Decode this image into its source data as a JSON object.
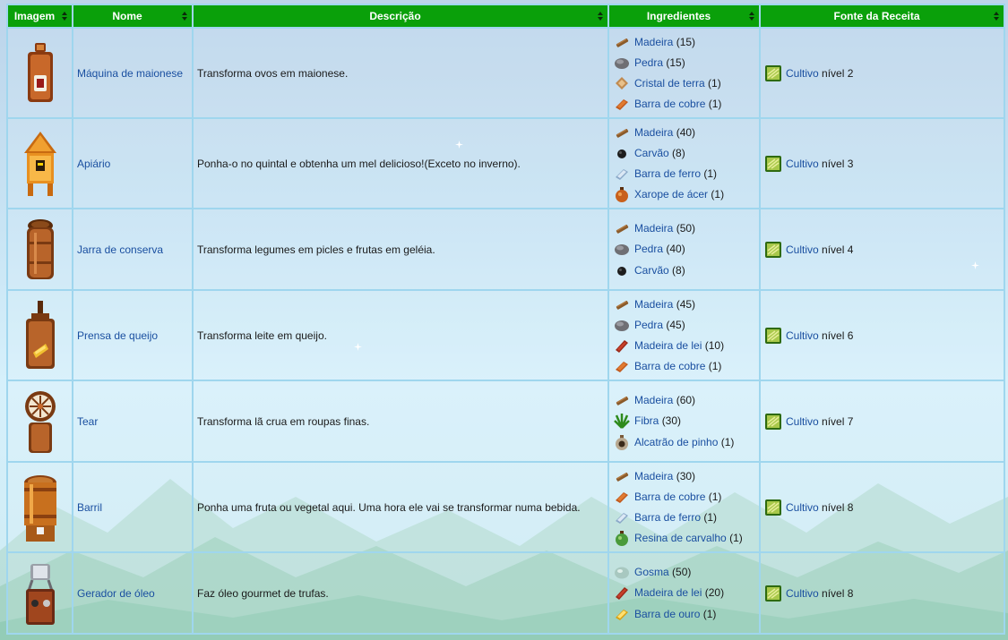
{
  "headers": {
    "image": "Imagem",
    "name": "Nome",
    "description": "Descrição",
    "ingredients": "Ingredientes",
    "source": "Fonte da Receita"
  },
  "rows": [
    {
      "icon": "mayonnaise-machine-icon",
      "name": "Máquina de maionese",
      "description": "Transforma ovos em maionese.",
      "ingredients": [
        {
          "icon": "wood-icon",
          "name": "Madeira",
          "qty": "(15)"
        },
        {
          "icon": "stone-icon",
          "name": "Pedra",
          "qty": "(15)"
        },
        {
          "icon": "earth-crystal-icon",
          "name": "Cristal de terra",
          "qty": "(1)"
        },
        {
          "icon": "copper-bar-icon",
          "name": "Barra de cobre",
          "qty": "(1)"
        }
      ],
      "source": {
        "link": "Cultivo",
        "level": "nível 2"
      }
    },
    {
      "icon": "bee-house-icon",
      "name": "Apiário",
      "description": "Ponha-o no quintal e obtenha um mel delicioso!(Exceto no inverno).",
      "ingredients": [
        {
          "icon": "wood-icon",
          "name": "Madeira",
          "qty": "(40)"
        },
        {
          "icon": "coal-icon",
          "name": "Carvão",
          "qty": "(8)"
        },
        {
          "icon": "iron-bar-icon",
          "name": "Barra de ferro",
          "qty": "(1)"
        },
        {
          "icon": "maple-syrup-icon",
          "name": "Xarope de ácer",
          "qty": "(1)"
        }
      ],
      "source": {
        "link": "Cultivo",
        "level": "nível 3"
      }
    },
    {
      "icon": "preserves-jar-icon",
      "name": "Jarra de conserva",
      "description": "Transforma legumes em picles e frutas em geléia.",
      "ingredients": [
        {
          "icon": "wood-icon",
          "name": "Madeira",
          "qty": "(50)"
        },
        {
          "icon": "stone-icon",
          "name": "Pedra",
          "qty": "(40)"
        },
        {
          "icon": "coal-icon",
          "name": "Carvão",
          "qty": "(8)"
        }
      ],
      "source": {
        "link": "Cultivo",
        "level": "nível 4"
      }
    },
    {
      "icon": "cheese-press-icon",
      "name": "Prensa de queijo",
      "description": "Transforma leite em queijo.",
      "ingredients": [
        {
          "icon": "wood-icon",
          "name": "Madeira",
          "qty": "(45)"
        },
        {
          "icon": "stone-icon",
          "name": "Pedra",
          "qty": "(45)"
        },
        {
          "icon": "hardwood-icon",
          "name": "Madeira de lei",
          "qty": "(10)"
        },
        {
          "icon": "copper-bar-icon",
          "name": "Barra de cobre",
          "qty": "(1)"
        }
      ],
      "source": {
        "link": "Cultivo",
        "level": "nível 6"
      }
    },
    {
      "icon": "loom-icon",
      "name": "Tear",
      "description": "Transforma lã crua em roupas finas.",
      "ingredients": [
        {
          "icon": "wood-icon",
          "name": "Madeira",
          "qty": "(60)"
        },
        {
          "icon": "fiber-icon",
          "name": "Fibra",
          "qty": "(30)"
        },
        {
          "icon": "pine-tar-icon",
          "name": "Alcatrão de pinho",
          "qty": "(1)"
        }
      ],
      "source": {
        "link": "Cultivo",
        "level": "nível 7"
      }
    },
    {
      "icon": "keg-icon",
      "name": "Barril",
      "description": "Ponha uma fruta ou vegetal aqui. Uma hora ele vai se transformar numa bebida.",
      "ingredients": [
        {
          "icon": "wood-icon",
          "name": "Madeira",
          "qty": "(30)"
        },
        {
          "icon": "copper-bar-icon",
          "name": "Barra de cobre",
          "qty": "(1)"
        },
        {
          "icon": "iron-bar-icon",
          "name": "Barra de ferro",
          "qty": "(1)"
        },
        {
          "icon": "oak-resin-icon",
          "name": "Resina de carvalho",
          "qty": "(1)"
        }
      ],
      "source": {
        "link": "Cultivo",
        "level": "nível 8"
      }
    },
    {
      "icon": "oil-maker-icon",
      "name": "Gerador de óleo",
      "description": "Faz óleo gourmet de trufas.",
      "ingredients": [
        {
          "icon": "slime-icon",
          "name": "Gosma",
          "qty": "(50)"
        },
        {
          "icon": "hardwood-icon",
          "name": "Madeira de lei",
          "qty": "(20)"
        },
        {
          "icon": "gold-bar-icon",
          "name": "Barra de ouro",
          "qty": "(1)"
        }
      ],
      "source": {
        "link": "Cultivo",
        "level": "nível 8"
      }
    }
  ],
  "colors": {
    "header_bg": "#0aa00a",
    "header_text": "#ffffff",
    "link": "#1a4fa0",
    "border": "#9fd6ee"
  }
}
